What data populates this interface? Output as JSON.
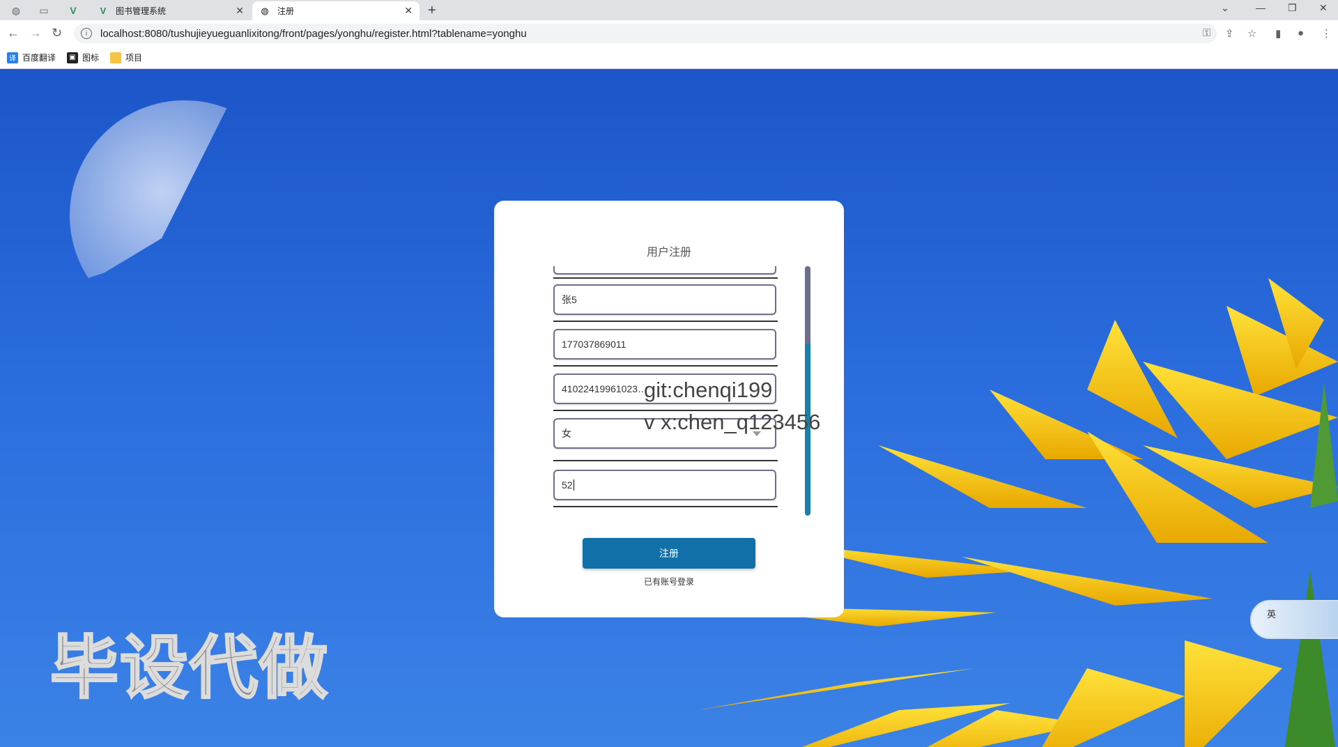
{
  "browser": {
    "tabs": [
      {
        "title": "图书管理系统",
        "active": false
      },
      {
        "title": "注册",
        "active": true
      }
    ],
    "url": "localhost:8080/tushujieyueguanlixitong/front/pages/yonghu/register.html?tablename=yonghu",
    "bookmarks": [
      "百度翻译",
      "图标",
      "项目"
    ],
    "icons": {
      "back": "arrow-left-icon",
      "forward": "arrow-right-icon",
      "reload": "reload-icon",
      "new_tab": "plus-icon"
    }
  },
  "register": {
    "title": "用户注册",
    "fields": [
      {
        "value": "",
        "kind": "input"
      },
      {
        "value": "张5",
        "kind": "input"
      },
      {
        "value": "177037869011",
        "kind": "input"
      },
      {
        "value": "41022419961023…",
        "kind": "input"
      },
      {
        "value": "女",
        "kind": "select"
      },
      {
        "value": "52",
        "kind": "input",
        "focused": true
      }
    ],
    "submit_label": "注册",
    "login_link": "已有账号登录",
    "scroll_position": 0.31
  },
  "overlays": {
    "git": "git:chenqi199",
    "wechat": "v x:chen_q123456",
    "big_watermark": "毕设代做",
    "ime_label": "英"
  },
  "colors": {
    "accent": "#1170a8",
    "scroll_track": "#1c7fa8",
    "scroll_thumb": "#6e6e8a",
    "background_sky": "#2a6cdd",
    "click_indicator": "#f05a64"
  }
}
